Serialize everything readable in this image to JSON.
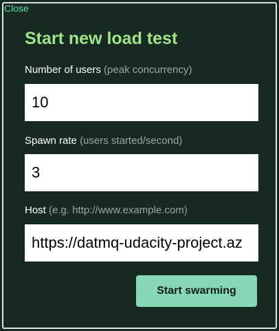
{
  "close_label": "Close",
  "title": "Start new load test",
  "fields": {
    "users": {
      "label": "Number of users",
      "hint": "(peak concurrency)",
      "value": "10"
    },
    "spawn_rate": {
      "label": "Spawn rate",
      "hint": "(users started/second)",
      "value": "3"
    },
    "host": {
      "label": "Host",
      "hint": "(e.g. http://www.example.com)",
      "value": "https://datmq-udacity-project.az"
    }
  },
  "submit_label": "Start swarming",
  "colors": {
    "background": "#162a22",
    "title": "#a2e28a",
    "close_link": "#5fe0a0",
    "button": "#86d8b7",
    "hint": "#9aa7a1"
  }
}
